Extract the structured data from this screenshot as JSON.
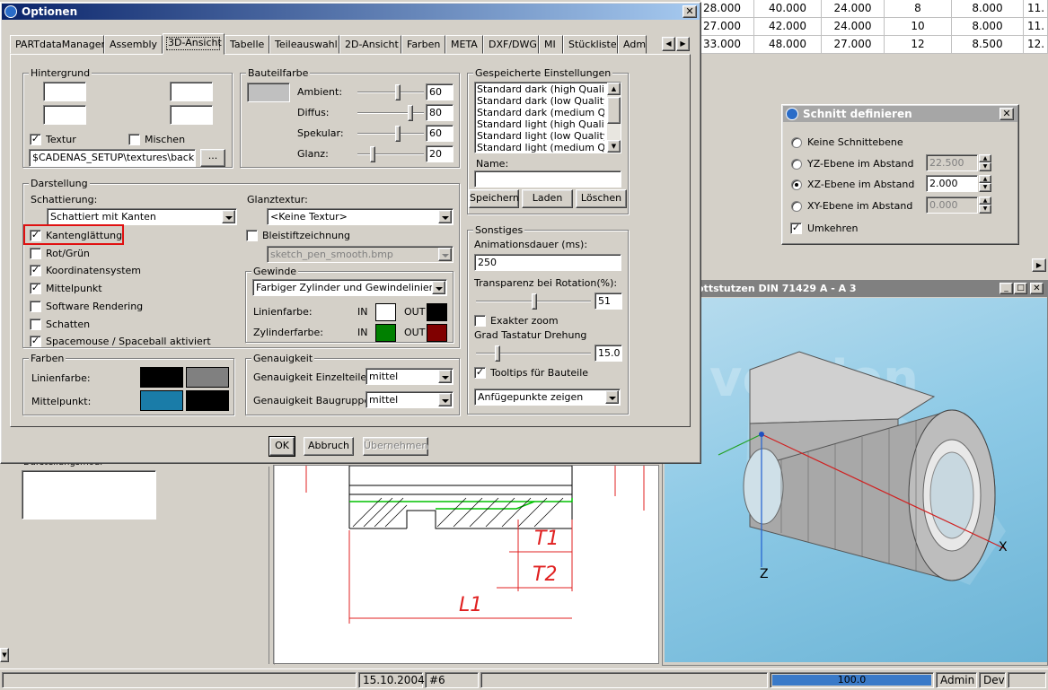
{
  "table": {
    "rows": [
      [
        "28.000",
        "40.000",
        "24.000",
        "8",
        "8.000",
        "11."
      ],
      [
        "27.000",
        "42.000",
        "24.000",
        "10",
        "8.000",
        "11."
      ],
      [
        "33.000",
        "48.000",
        "27.000",
        "12",
        "8.500",
        "12."
      ]
    ]
  },
  "dialog": {
    "title": "Optionen",
    "tabs": [
      "PARTdataManager",
      "Assembly",
      "3D-Ansicht",
      "Tabelle",
      "Teileauswahl",
      "2D-Ansicht",
      "Farben",
      "META",
      "DXF/DWG",
      "MI",
      "Stückliste",
      "Admi"
    ],
    "active_tab": "3D-Ansicht",
    "hintergrund": {
      "title": "Hintergrund",
      "textur_label": "Textur",
      "textur_checked": true,
      "mischen_label": "Mischen",
      "mischen_checked": false,
      "path": "$CADENAS_SETUP\\textures\\backgr",
      "browse": "..."
    },
    "bauteilfarbe": {
      "title": "Bauteilfarbe",
      "sliders": [
        {
          "label": "Ambient:",
          "value": "60",
          "pos": 0.6
        },
        {
          "label": "Diffus:",
          "value": "80",
          "pos": 0.8
        },
        {
          "label": "Spekular:",
          "value": "60",
          "pos": 0.6
        },
        {
          "label": "Glanz:",
          "value": "20",
          "pos": 0.2
        }
      ]
    },
    "gespeichert": {
      "title": "Gespeicherte Einstellungen",
      "items": [
        "Standard dark (high Quality)",
        "Standard dark (low Quality)",
        "Standard dark (medium Quality",
        "Standard light (high Quality)",
        "Standard light (low Quality)",
        "Standard light (medium Quality"
      ],
      "name_label": "Name:",
      "name_value": "",
      "save": "Speichern",
      "load": "Laden",
      "delete": "Löschen"
    },
    "darstellung": {
      "title": "Darstellung",
      "schattierung_label": "Schattierung:",
      "schattierung_value": "Schattiert mit Kanten",
      "glanztextur_label": "Glanztextur:",
      "glanztextur_value": "<Keine Textur>",
      "bleistift_label": "Bleistiftzeichnung",
      "bleistift_checked": false,
      "bleistift_file": "sketch_pen_smooth.bmp",
      "checks": [
        {
          "label": "Kantenglättung",
          "checked": true
        },
        {
          "label": "Rot/Grün",
          "checked": false
        },
        {
          "label": "Koordinatensystem",
          "checked": true
        },
        {
          "label": "Mittelpunkt",
          "checked": true
        },
        {
          "label": "Software Rendering",
          "checked": false
        },
        {
          "label": "Schatten",
          "checked": false
        },
        {
          "label": "Spacemouse / Spaceball aktiviert",
          "checked": true
        }
      ],
      "gewinde": {
        "title": "Gewinde",
        "value": "Farbiger Zylinder und Gewindelinien",
        "linienfarbe": "Linienfarbe:",
        "zylinderfarbe": "Zylinderfarbe:",
        "in": "IN",
        "out": "OUT",
        "line_in_color": "#ffffff",
        "line_out_color": "#000000",
        "cyl_in_color": "#008000",
        "cyl_out_color": "#800000"
      }
    },
    "sonstiges": {
      "title": "Sonstiges",
      "anim_label": "Animationsdauer (ms):",
      "anim_value": "250",
      "transparenz_label": "Transparenz bei Rotation(%):",
      "transparenz_value": "51",
      "transparenz_pos": 0.51,
      "zoom_label": "Exakter zoom",
      "zoom_checked": false,
      "grad_label": "Grad Tastatur Drehung",
      "grad_value": "15.0",
      "grad_pos": 0.17,
      "tooltips_label": "Tooltips für Bauteile",
      "tooltips_checked": true,
      "anfuege_value": "Anfügepunkte zeigen"
    },
    "farben": {
      "title": "Farben",
      "linienfarbe": "Linienfarbe:",
      "mittelpunkt": "Mittelpunkt:",
      "line_colors": [
        "#000000",
        "#808080"
      ],
      "mid_colors": [
        "#1a7ca8",
        "#000000"
      ]
    },
    "genauigkeit": {
      "title": "Genauigkeit",
      "einzelteile_label": "Genauigkeit Einzelteile:",
      "einzelteile_value": "mittel",
      "baugruppen_label": "Genauigkeit Baugruppen:",
      "baugruppen_value": "mittel"
    },
    "buttons": {
      "ok": "OK",
      "cancel": "Abbruch",
      "apply": "Übernehmen"
    }
  },
  "schnitt": {
    "title": "Schnitt definieren",
    "options": [
      {
        "label": "Keine Schnittebene",
        "selected": false,
        "value": ""
      },
      {
        "label": "YZ-Ebene im Abstand",
        "selected": false,
        "value": "22.500"
      },
      {
        "label": "XZ-Ebene im Abstand",
        "selected": true,
        "value": "2.000"
      },
      {
        "label": "XY-Ebene im Abstand",
        "selected": false,
        "value": "0.000"
      }
    ],
    "umkehren_label": "Umkehren",
    "umkehren_checked": true
  },
  "view3d": {
    "title": "ottstutzen DIN 71429 A - A 3",
    "watermark": "version",
    "axis_x": "X",
    "axis_z": "Z"
  },
  "drawing": {
    "t1": "T1",
    "t2": "T2",
    "l1": "L1"
  },
  "left_panel": {
    "label": "Darstellungsmodi"
  },
  "status": {
    "date": "15.10.2004",
    "num": "#6",
    "progress": "100.0",
    "progress_pct": 100,
    "user": "Admin",
    "mode": "Dev"
  }
}
